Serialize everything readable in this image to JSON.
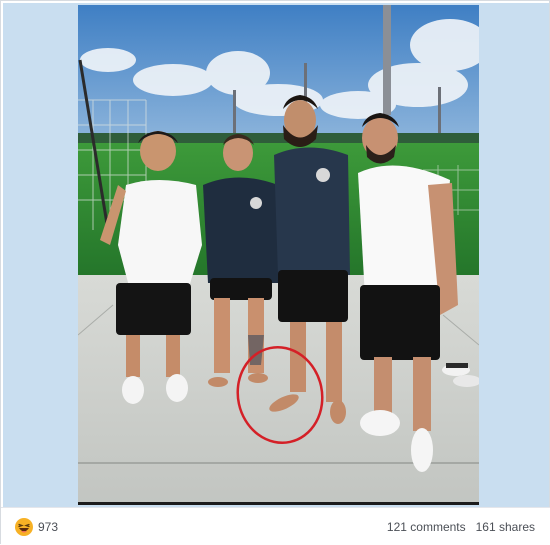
{
  "post": {
    "photo_alt": "",
    "reactions": {
      "icon": "haha-icon",
      "count": "973"
    },
    "comments_label": "121 comments",
    "shares_label": "161 shares"
  },
  "colors": {
    "side_panel": "#c9def0",
    "sky": "#4a88c8",
    "field": "#2f8a2e",
    "concrete": "#cfd2cf",
    "annotation_circle": "#d42027",
    "haha_yellow": "#f7b125"
  }
}
